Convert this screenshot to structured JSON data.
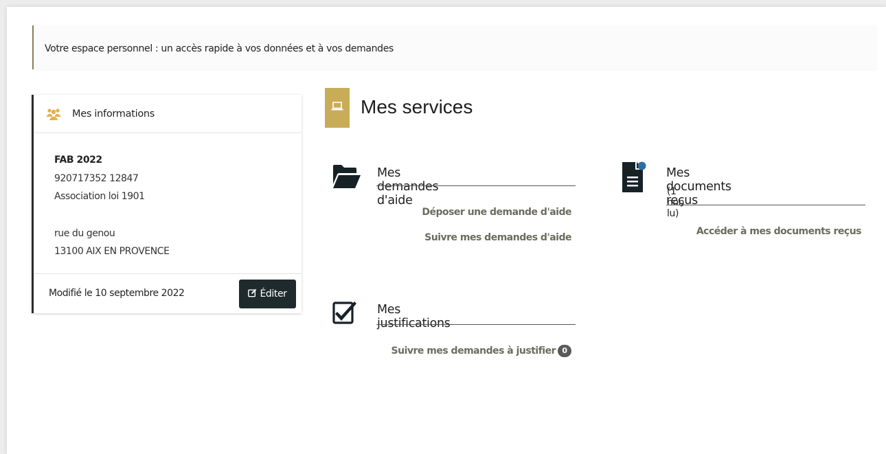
{
  "intro": {
    "text": "Votre espace personnel : un accès rapide à vos données et à vos demandes"
  },
  "info_card": {
    "title": "Mes informations",
    "icon": "users-icon",
    "org_name": "FAB 2022",
    "siret": "920717352 12847",
    "legal_form": "Association loi 1901",
    "street": "rue du genou",
    "city": "13100 AIX EN PROVENCE",
    "modified": "Modifié le 10 septembre 2022",
    "edit_label": "Éditer",
    "edit_icon": "edit-icon"
  },
  "services": {
    "title": "Mes services",
    "icon": "laptop-icon",
    "accent_color": "#c9ac57",
    "demandes": {
      "title": "Mes demandes d'aide",
      "icon": "folder-open-icon",
      "links": [
        "Déposer une demande d'aide",
        "Suivre mes demandes d'aide"
      ]
    },
    "documents": {
      "title": "Mes documents reçus",
      "icon": "document-notification-icon",
      "subtitle": "(1 non lu)",
      "link": "Accéder à mes documents reçus"
    },
    "justifications": {
      "title": "Mes justifications",
      "icon": "checkbox-checked-icon",
      "link": "Suivre mes demandes à justifier",
      "badge": "0"
    }
  }
}
